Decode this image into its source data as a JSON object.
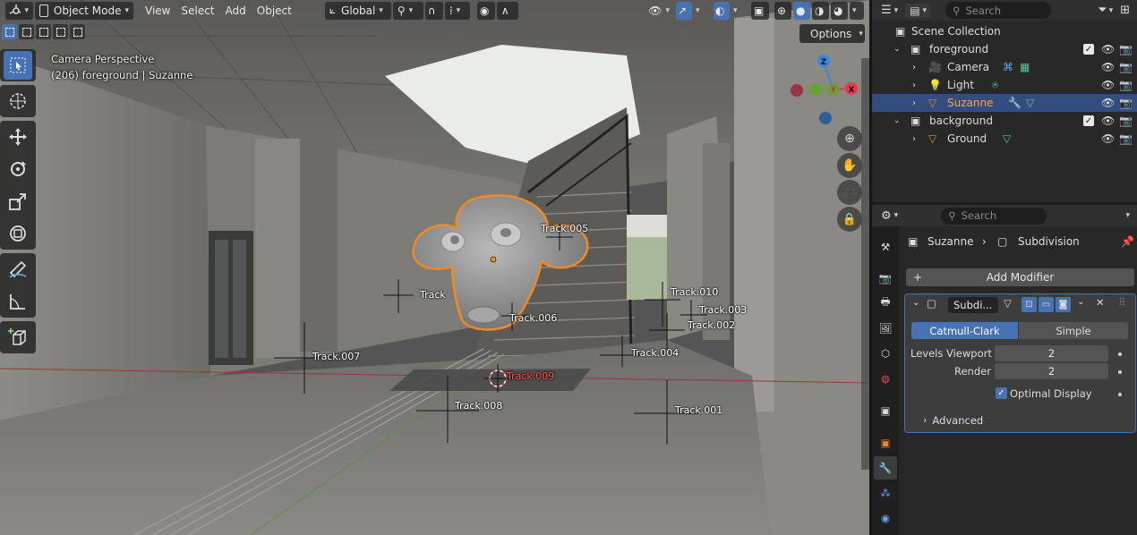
{
  "viewport": {
    "header": {
      "mode_label": "Object Mode",
      "menus": [
        "View",
        "Select",
        "Add",
        "Object"
      ],
      "transform_orientation": "Global"
    },
    "options_label": "Options",
    "overlay_info": {
      "line1": "Camera Perspective",
      "line2": "(206) foreground | Suzanne"
    },
    "gizmo_axes": {
      "z": "Z",
      "y": "Y",
      "x": "X"
    },
    "tracks": [
      "Track.005",
      "Track",
      "Track.006",
      "Track.010",
      "Track.003",
      "Track.002",
      "Track.004",
      "Track.007",
      "Track.009",
      "Track.008",
      "Track.001"
    ],
    "tools": [
      "select-box",
      "cursor",
      "move",
      "rotate",
      "scale",
      "transform",
      "annotate",
      "measure",
      "add-cube"
    ]
  },
  "outliner": {
    "search_placeholder": "Search",
    "scene_collection": "Scene Collection",
    "items": [
      {
        "name": "foreground",
        "type": "collection",
        "level": 0,
        "checked": true
      },
      {
        "name": "Camera",
        "type": "camera",
        "level": 1
      },
      {
        "name": "Light",
        "type": "light",
        "level": 1
      },
      {
        "name": "Suzanne",
        "type": "mesh",
        "level": 1,
        "selected": true
      },
      {
        "name": "background",
        "type": "collection",
        "level": 0,
        "checked": true
      },
      {
        "name": "Ground",
        "type": "mesh",
        "level": 1
      }
    ]
  },
  "properties": {
    "search_placeholder": "Search",
    "breadcrumb": {
      "object": "Suzanne",
      "modifier": "Subdivision"
    },
    "add_modifier_label": "Add Modifier",
    "modifier": {
      "name": "Subdi...",
      "algorithm_options": [
        "Catmull-Clark",
        "Simple"
      ],
      "algorithm_selected": "Catmull-Clark",
      "levels_viewport_label": "Levels Viewport",
      "levels_viewport": "2",
      "render_label": "Render",
      "render": "2",
      "optimal_display_label": "Optimal Display",
      "optimal_display": true,
      "advanced_label": "Advanced"
    }
  },
  "colors": {
    "accent": "#4772b3",
    "selection_outline": "#f08a28",
    "axis_x": "#e8384e",
    "axis_y": "#6c9f32",
    "axis_z": "#3e86e0"
  }
}
